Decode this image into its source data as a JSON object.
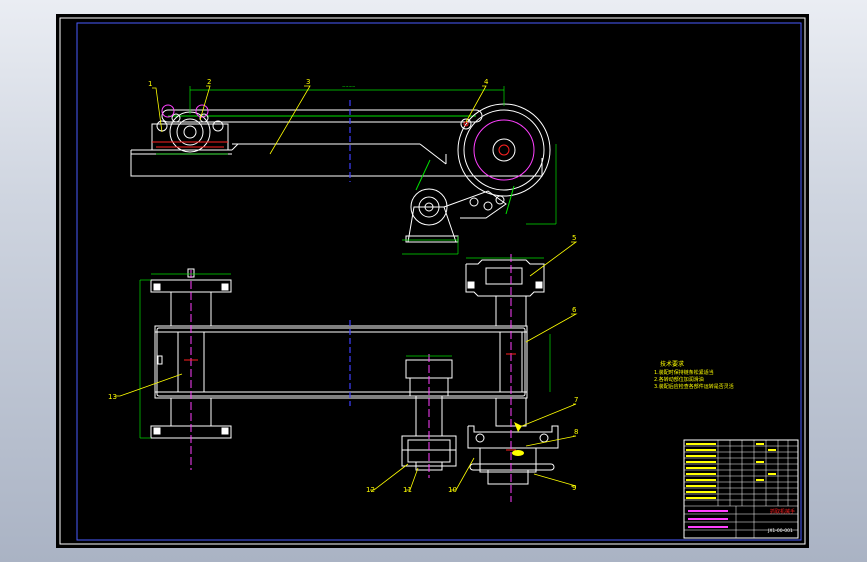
{
  "colors": {
    "background": "#c8cfdc",
    "sheet": "#000000",
    "frame": "#ffffff",
    "inner_frame": "#4a5cff",
    "geometry": "#ffffff",
    "dimension": "#00e000",
    "centerline_blue": "#4040ff",
    "centerline_magenta": "#ff40ff",
    "leader": "#ffff00",
    "red": "#ff2020",
    "cyan": "#00ffff"
  },
  "balloons": {
    "b1": "1",
    "b2": "2",
    "b3": "3",
    "b4": "4",
    "b5": "5",
    "b6": "6",
    "b7": "7",
    "b8": "8",
    "b9": "9",
    "b10": "10",
    "b11": "11",
    "b12": "12",
    "b13": "13"
  },
  "tech_req": {
    "title": "技术要求",
    "line1": "1.装配时保持链条松紧适当",
    "line2": "2.各转动部位加润滑油",
    "line3": "3.装配后应检查各部件运转是否灵活"
  },
  "title_block": {
    "drawing_name": "抓取机械手",
    "drawing_no": "JX1-00-001"
  }
}
